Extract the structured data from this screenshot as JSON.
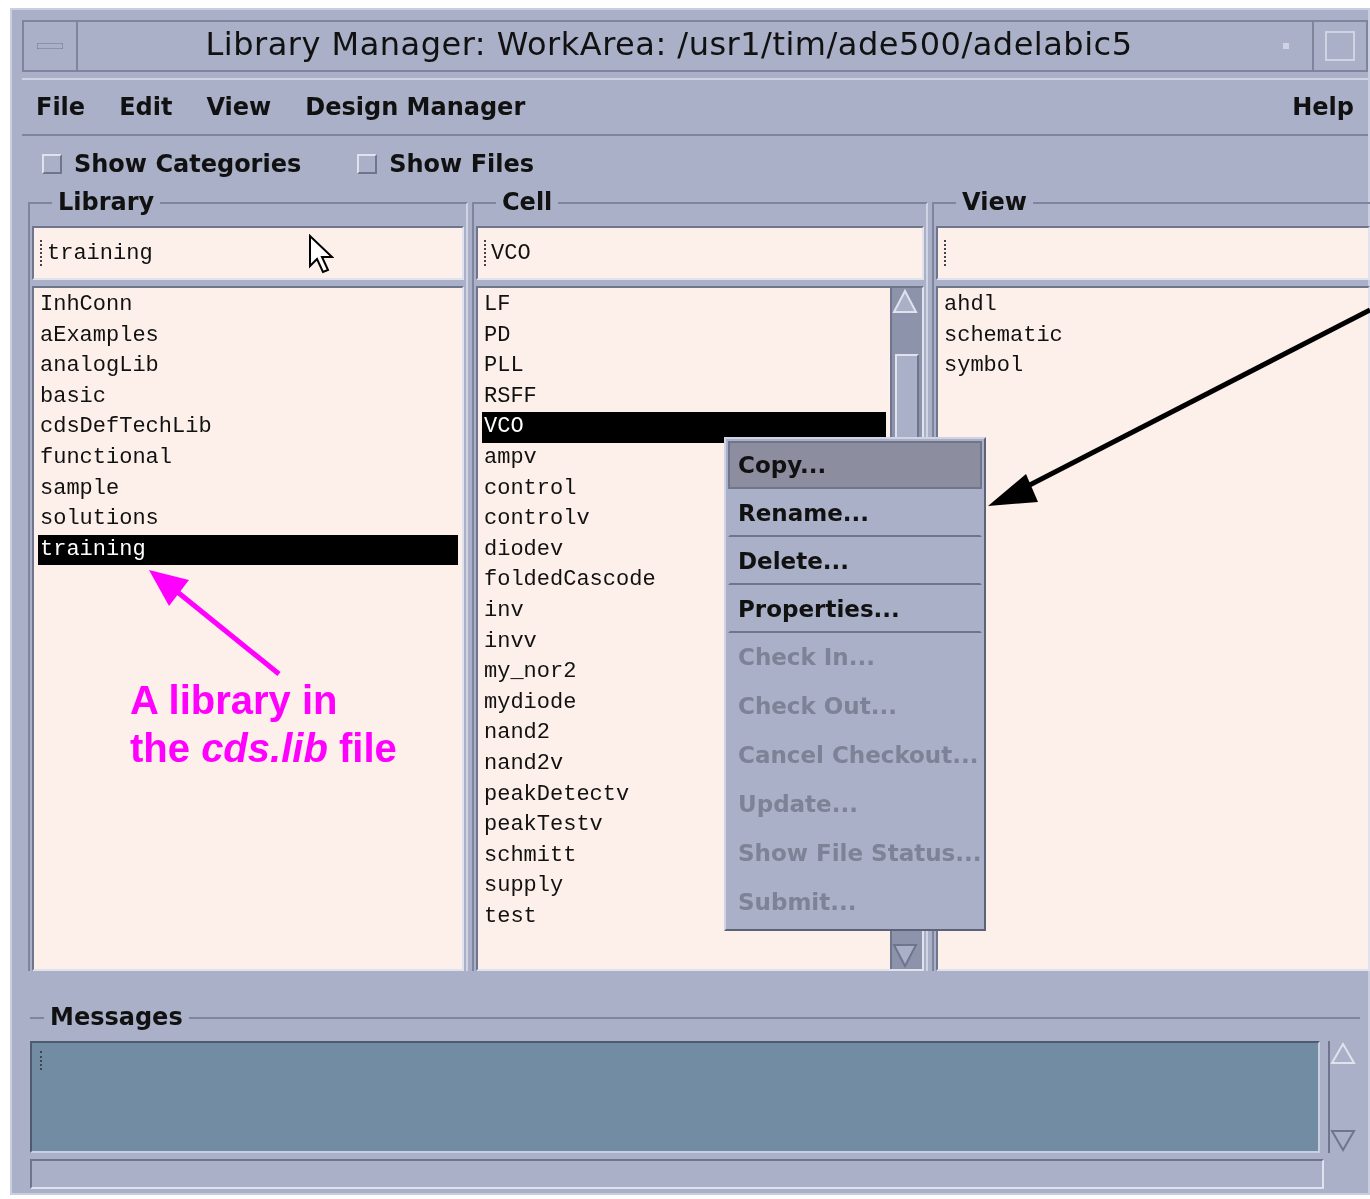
{
  "window": {
    "title": "Library Manager: WorkArea: /usr1/tim/ade500/adelabic5"
  },
  "menu_bar": {
    "left": [
      "File",
      "Edit",
      "View",
      "Design Manager"
    ],
    "right": [
      "Help"
    ]
  },
  "options": [
    {
      "label": "Show Categories",
      "checked": false
    },
    {
      "label": "Show Files",
      "checked": false
    }
  ],
  "panes": [
    {
      "title": "Library",
      "value": "training",
      "has_scrollbar": false,
      "items": [
        {
          "label": "InhConn",
          "selected": false
        },
        {
          "label": "aExamples",
          "selected": false
        },
        {
          "label": "analogLib",
          "selected": false
        },
        {
          "label": "basic",
          "selected": false
        },
        {
          "label": "cdsDefTechLib",
          "selected": false
        },
        {
          "label": "functional",
          "selected": false
        },
        {
          "label": "sample",
          "selected": false
        },
        {
          "label": "solutions",
          "selected": false
        },
        {
          "label": "training",
          "selected": true
        }
      ]
    },
    {
      "title": "Cell",
      "value": "VCO",
      "has_scrollbar": true,
      "items": [
        {
          "label": "LF",
          "selected": false
        },
        {
          "label": "PD",
          "selected": false
        },
        {
          "label": "PLL",
          "selected": false
        },
        {
          "label": "RSFF",
          "selected": false
        },
        {
          "label": "VCO",
          "selected": true
        },
        {
          "label": "ampv",
          "selected": false
        },
        {
          "label": "control",
          "selected": false
        },
        {
          "label": "controlv",
          "selected": false
        },
        {
          "label": "diodev",
          "selected": false
        },
        {
          "label": "foldedCascode",
          "selected": false
        },
        {
          "label": "inv",
          "selected": false
        },
        {
          "label": "invv",
          "selected": false
        },
        {
          "label": "my_nor2",
          "selected": false
        },
        {
          "label": "mydiode",
          "selected": false
        },
        {
          "label": "nand2",
          "selected": false
        },
        {
          "label": "nand2v",
          "selected": false
        },
        {
          "label": "peakDetectv",
          "selected": false
        },
        {
          "label": "peakTestv",
          "selected": false
        },
        {
          "label": "schmitt",
          "selected": false
        },
        {
          "label": "supply",
          "selected": false
        },
        {
          "label": "test",
          "selected": false
        }
      ]
    },
    {
      "title": "View",
      "has_scrollbar": false,
      "items": [
        {
          "label": "ahdl",
          "selected": false
        },
        {
          "label": "schematic",
          "selected": false
        },
        {
          "label": "symbol",
          "selected": false
        }
      ]
    }
  ],
  "context_menu": [
    {
      "label": "Copy...",
      "selected": true,
      "disabled": false
    },
    {
      "label": "Rename...",
      "selected": false,
      "disabled": false
    },
    {
      "label": "Delete...",
      "selected": false,
      "disabled": false
    },
    {
      "label": "Properties...",
      "selected": false,
      "disabled": false
    },
    {
      "label": "Check In...",
      "selected": false,
      "disabled": true
    },
    {
      "label": "Check Out...",
      "selected": false,
      "disabled": true
    },
    {
      "label": "Cancel Checkout...",
      "selected": false,
      "disabled": true
    },
    {
      "label": "Update...",
      "selected": false,
      "disabled": true
    },
    {
      "label": "Show File Status...",
      "selected": false,
      "disabled": true
    },
    {
      "label": "Submit...",
      "selected": false,
      "disabled": true
    }
  ],
  "messages": {
    "title": "Messages"
  },
  "annotation": {
    "lines": [
      "A library in",
      "the *cds.lib* file"
    ]
  }
}
